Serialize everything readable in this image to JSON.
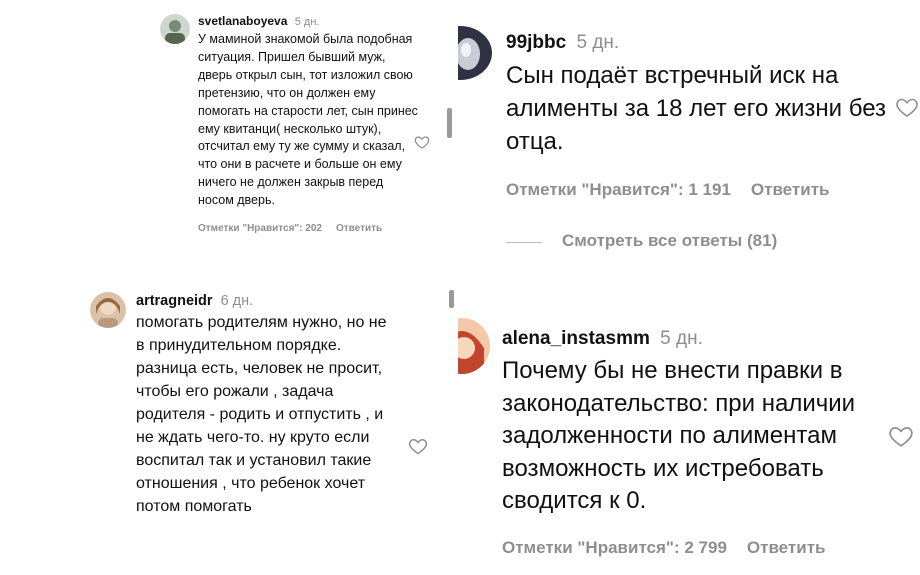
{
  "comments": [
    {
      "user": "svetlanaboyeva",
      "time": "5 дн.",
      "text": "У маминой знакомой была подобная ситуация. Пришел бывший муж, дверь открыл сын, тот изложил свою претензию, что он должен ему помогать на старости лет, сын принес ему квитанци( несколько штук), отсчитал ему ту же сумму и сказал, что они в расчете и больше он ему ничего не должен закрыв перед носом дверь.",
      "likes": "Отметки \"Нравится\": 202",
      "reply": "Ответить"
    },
    {
      "user": "artragneidr",
      "time": "6 дн.",
      "text": "помогать родителям нужно, но не в принудительном порядке. разница есть, человек не просит, чтобы его рожали , задача родителя - родить и отпустить , и не ждать чего-то. ну круто если воспитал так и установил такие отношения , что ребенок хочет потом помогать"
    },
    {
      "user": "99jbbc",
      "time": "5 дн.",
      "text": "Сын подаёт встречный иск на алименты за 18 лет его жизни без отца.",
      "likes": "Отметки \"Нравится\": 1 191",
      "reply": "Ответить",
      "view_replies": "Смотреть все ответы (81)"
    },
    {
      "user": "alena_instasmm",
      "time": "5 дн.",
      "text": "Почему бы не внести правки в законодательство: при наличии задолженности по алиментам возможность их истребовать сводится к 0.",
      "likes": "Отметки \"Нравится\": 2 799",
      "reply": "Ответить"
    }
  ],
  "icons": {
    "like": "heart-outline-icon"
  },
  "colors": {
    "secondary_text": "#8e8e8e",
    "primary_text": "#111111"
  }
}
